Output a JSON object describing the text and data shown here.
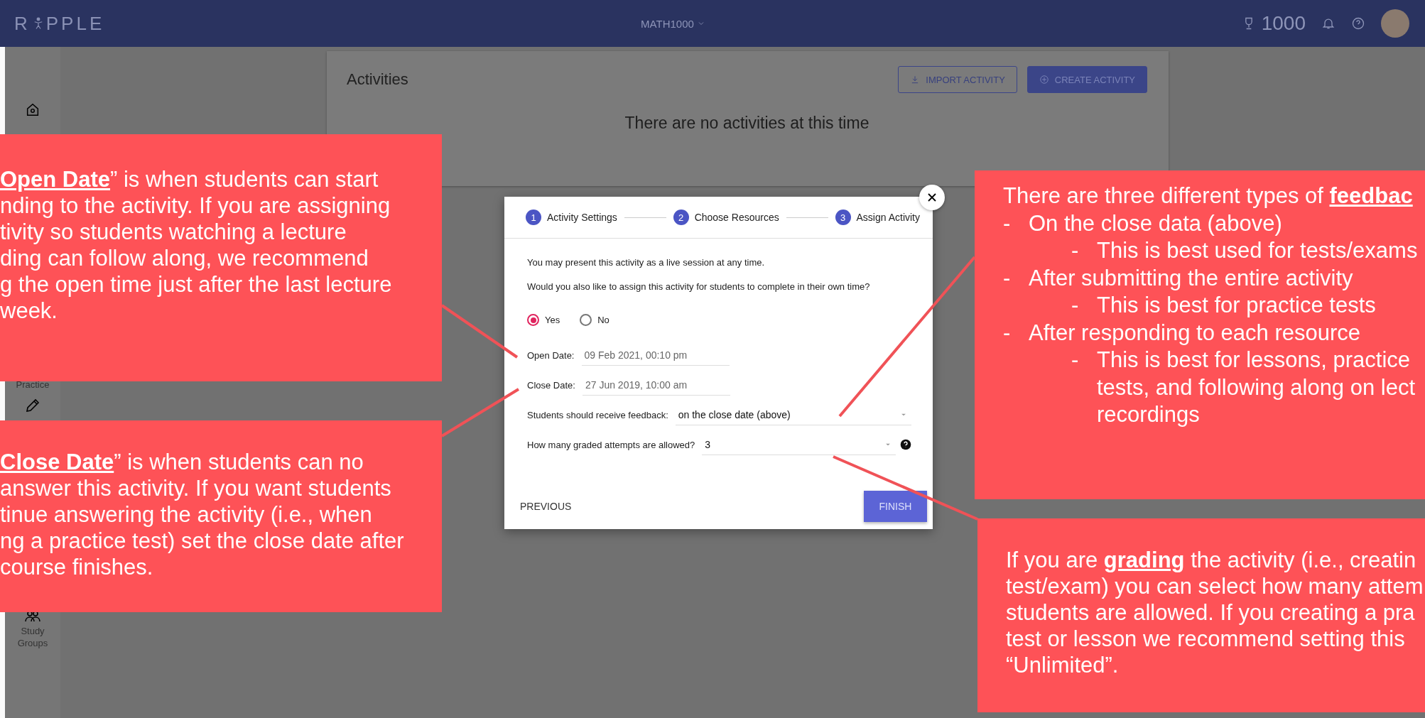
{
  "top_bar": {
    "logo_start": "R",
    "logo_end": "PPLE",
    "course": "MATH1000",
    "points": "1000"
  },
  "sidebar": {
    "practice_label": "Practice",
    "groups_label": "Study Groups"
  },
  "activities": {
    "title": "Activities",
    "buttons": [
      {
        "label": "IMPORT ACTIVITY",
        "kind": "outlined"
      },
      {
        "label": "CREATE ACTIVITY",
        "kind": "filled"
      }
    ],
    "empty_message": "There are no activities at this time"
  },
  "dialog": {
    "steps": [
      {
        "number": "1",
        "label": "Activity Settings"
      },
      {
        "number": "2",
        "label": "Choose Resources"
      },
      {
        "number": "3",
        "label": "Assign Activity"
      }
    ],
    "intro": "You may present this activity as a live session at any time.",
    "question": "Would you also like to assign this activity for students to complete in their own time?",
    "options": [
      {
        "label": "Yes",
        "selected": true
      },
      {
        "label": "No",
        "selected": false
      }
    ],
    "dates": [
      {
        "label": "Open Date:",
        "value": "09 Feb 2021, 00:10 pm"
      },
      {
        "label": "Close Date:",
        "value": "27 Jun 2019, 10:00 am"
      }
    ],
    "selects": [
      {
        "label": "Students should receive feedback:",
        "value": "on the close date (above)",
        "help": false
      },
      {
        "label": "How many graded attempts are allowed?",
        "value": "3",
        "help": true
      }
    ],
    "previous": "PREVIOUS",
    "finish": "FINISH"
  },
  "callouts": [
    {
      "kind": "left-top",
      "lines": [
        "**Open Date**” is when students can start",
        "nding to the activity. If you are assigning",
        "tivity so students watching a lecture",
        "ding can follow along, we recommend",
        "g the open time just after the last lecture",
        "week."
      ]
    },
    {
      "kind": "left-bottom",
      "lines": [
        "**Close Date**” is when students can no",
        "answer this activity. If you want students",
        "tinue answering the activity (i.e., when",
        "ng a practice test) set the close date after",
        "course finishes."
      ]
    },
    {
      "kind": "right-top",
      "intro": "There are three different types of **feedbac**",
      "items": [
        {
          "marker": "-",
          "text": "On the close data (above)",
          "children": [
            {
              "marker": "-",
              "lines": [
                "This is best used for tests/exams"
              ]
            }
          ]
        },
        {
          "marker": "-",
          "text": "After submitting the entire activity",
          "children": [
            {
              "marker": "-",
              "lines": [
                "This is best for practice tests"
              ]
            }
          ]
        },
        {
          "marker": "-",
          "text": "After responding to each resource",
          "children": [
            {
              "marker": "-",
              "lines": [
                "This is best for lessons, practice",
                "tests, and following along on lect",
                "recordings"
              ]
            }
          ]
        }
      ]
    },
    {
      "kind": "right-bottom",
      "lines": [
        "If you are **grading** the activity (i.e., creatin",
        "test/exam) you can select how many attem",
        "students are allowed. If you creating a pra",
        "test or lesson we recommend setting this",
        "“Unlimited”."
      ]
    }
  ]
}
